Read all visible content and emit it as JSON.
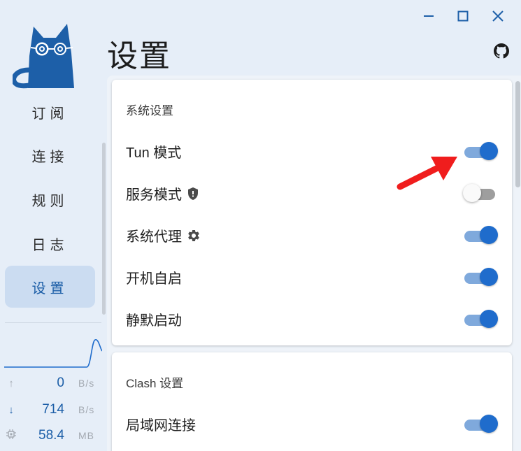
{
  "window": {
    "title": "设置",
    "controls": [
      "minimize",
      "maximize",
      "close"
    ]
  },
  "sidebar": {
    "items": [
      {
        "label": "订阅",
        "active": false
      },
      {
        "label": "连接",
        "active": false
      },
      {
        "label": "规则",
        "active": false
      },
      {
        "label": "日志",
        "active": false
      },
      {
        "label": "设置",
        "active": true
      }
    ],
    "traffic": {
      "upload": {
        "value": "0",
        "unit": "B/s"
      },
      "download": {
        "value": "714",
        "unit": "B/s"
      },
      "memory": {
        "value": "58.4",
        "unit": "MB"
      }
    }
  },
  "main": {
    "system_card": {
      "title": "系统设置",
      "rows": [
        {
          "label": "Tun 模式",
          "on": true,
          "icon": null
        },
        {
          "label": "服务模式",
          "on": false,
          "icon": "shield-icon"
        },
        {
          "label": "系统代理",
          "on": true,
          "icon": "gear-icon"
        },
        {
          "label": "开机自启",
          "on": true,
          "icon": null
        },
        {
          "label": "静默启动",
          "on": true,
          "icon": null
        }
      ]
    },
    "clash_card": {
      "title": "Clash 设置",
      "rows": [
        {
          "label": "局域网连接",
          "on": true
        }
      ]
    }
  },
  "colors": {
    "accent": "#1f6ccc",
    "accent_track": "#7fa9dc",
    "active_nav_bg": "#cbdcf1",
    "annotation_arrow": "#f01d1d"
  }
}
